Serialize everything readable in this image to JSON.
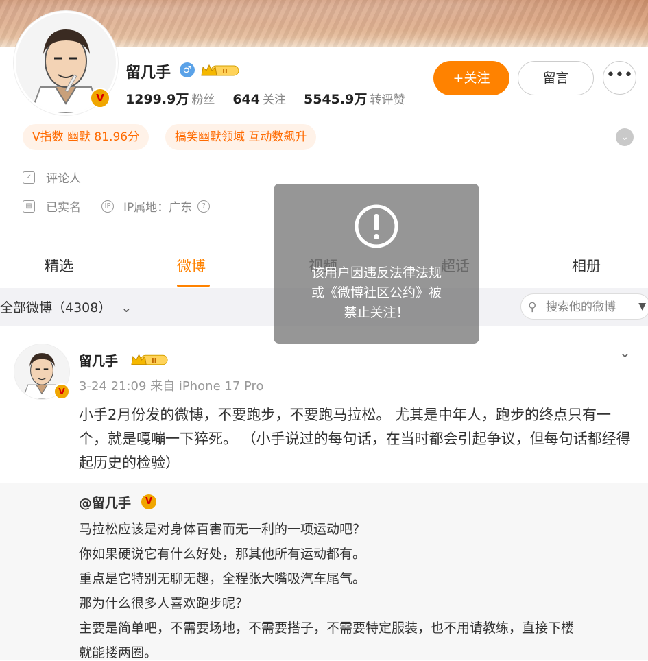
{
  "profile": {
    "name": "留几手",
    "gender_symbol": "♂",
    "level_badge": "II",
    "verified_mark": "V",
    "stats": [
      {
        "value": "1299.9万",
        "label": "粉丝"
      },
      {
        "value": "644",
        "label": "关注"
      },
      {
        "value": "5545.9万",
        "label": "转评赞"
      }
    ],
    "follow_button": "+关注",
    "message_button": "留言",
    "more_button": "•••",
    "pills": [
      "V指数 幽默 81.96分",
      "搞笑幽默领域 互动数飙升"
    ],
    "info": {
      "role": "评论人",
      "realname": "已实名",
      "ip": "IP属地：广东"
    }
  },
  "tabs": [
    "精选",
    "微博",
    "视频",
    "超话",
    "相册"
  ],
  "active_tab": "微博",
  "filter": {
    "label": "全部微博（4308）",
    "search_placeholder": "搜索他的微博"
  },
  "post": {
    "author": "留几手",
    "meta": "3-24 21:09 来自 iPhone 17 Pro",
    "text": "小手2月份发的微博，不要跑步，不要跑马拉松。 尤其是中年人，跑步的终点只有一个，就是嘎嘣一下猝死。 （小手说过的每句话，在当时都会引起争议，但每句话都经得起历史的检验）",
    "repost": {
      "author": "@留几手",
      "lines": [
        "马拉松应该是对身体百害而无一利的一项运动吧？",
        "你如果硬说它有什么好处，那其他所有运动都有。",
        "重点是它特别无聊无趣，全程张大嘴吸汽车尾气。",
        "那为什么很多人喜欢跑步呢？",
        "主要是简单吧，不需要场地，不需要搭子，不需要特定服装，也不用请教练，直接下楼",
        "就能搂两圈。"
      ]
    }
  },
  "overlay": {
    "line1": "该用户因违反法律法规",
    "line2": "或《微博社区公约》被",
    "line3": "禁止关注！"
  },
  "colors": {
    "accent": "#ff8200",
    "pill_bg": "#fff2e8",
    "pill_text": "#ff6a00"
  }
}
